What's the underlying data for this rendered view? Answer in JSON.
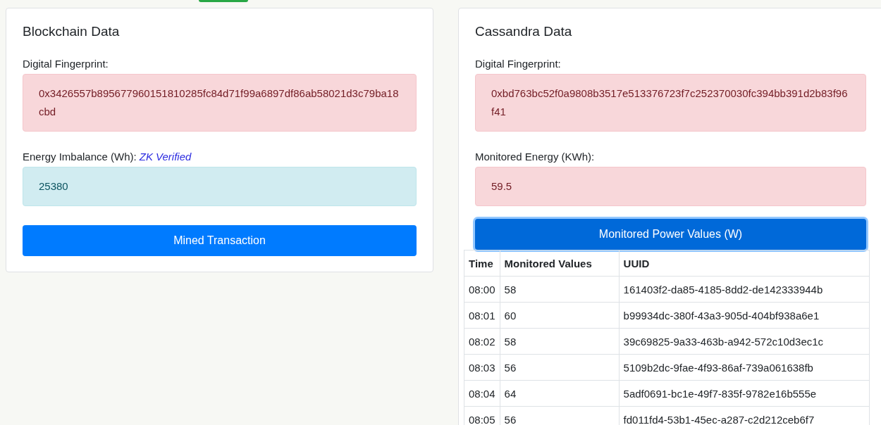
{
  "panels": [
    {
      "title": "Blockchain Data",
      "fields": [
        {
          "label": "Digital Fingerprint:",
          "value": "0x3426557b895677960151810285fc84d71f99a6897df86ab58021d3c79ba18cbd",
          "kind": "danger"
        },
        {
          "label": "Energy Imbalance (Wh):",
          "note": "ZK Verified",
          "value": "25380",
          "kind": "info"
        }
      ],
      "button": {
        "label": "Mined Transaction",
        "focused": false
      }
    },
    {
      "title": "Cassandra Data",
      "fields": [
        {
          "label": "Digital Fingerprint:",
          "value": "0xbd763bc52f0a9808b3517e513376723f7c252370030fc394bb391d2b83f96f41",
          "kind": "danger"
        },
        {
          "label": "Monitored Energy (KWh):",
          "value": "59.5",
          "kind": "danger"
        }
      ],
      "button": {
        "label": "Monitored Power Values (W)",
        "focused": true
      },
      "table": {
        "columns": [
          "Time",
          "Monitored Values",
          "UUID"
        ],
        "rows": [
          [
            "08:00",
            "58",
            "161403f2-da85-4185-8dd2-de142333944b"
          ],
          [
            "08:01",
            "60",
            "b99934dc-380f-43a3-905d-404bf938a6e1"
          ],
          [
            "08:02",
            "58",
            "39c69825-9a33-463b-a942-572c10d3ec1c"
          ],
          [
            "08:03",
            "56",
            "5109b2dc-9fae-4f93-86af-739a061638fb"
          ],
          [
            "08:04",
            "64",
            "5adf0691-bc1e-49f7-835f-9782e16b555e"
          ],
          [
            "08:05",
            "56",
            "fd011fd4-53b1-45ec-a287-c2d212ceb6f7"
          ]
        ]
      }
    }
  ]
}
